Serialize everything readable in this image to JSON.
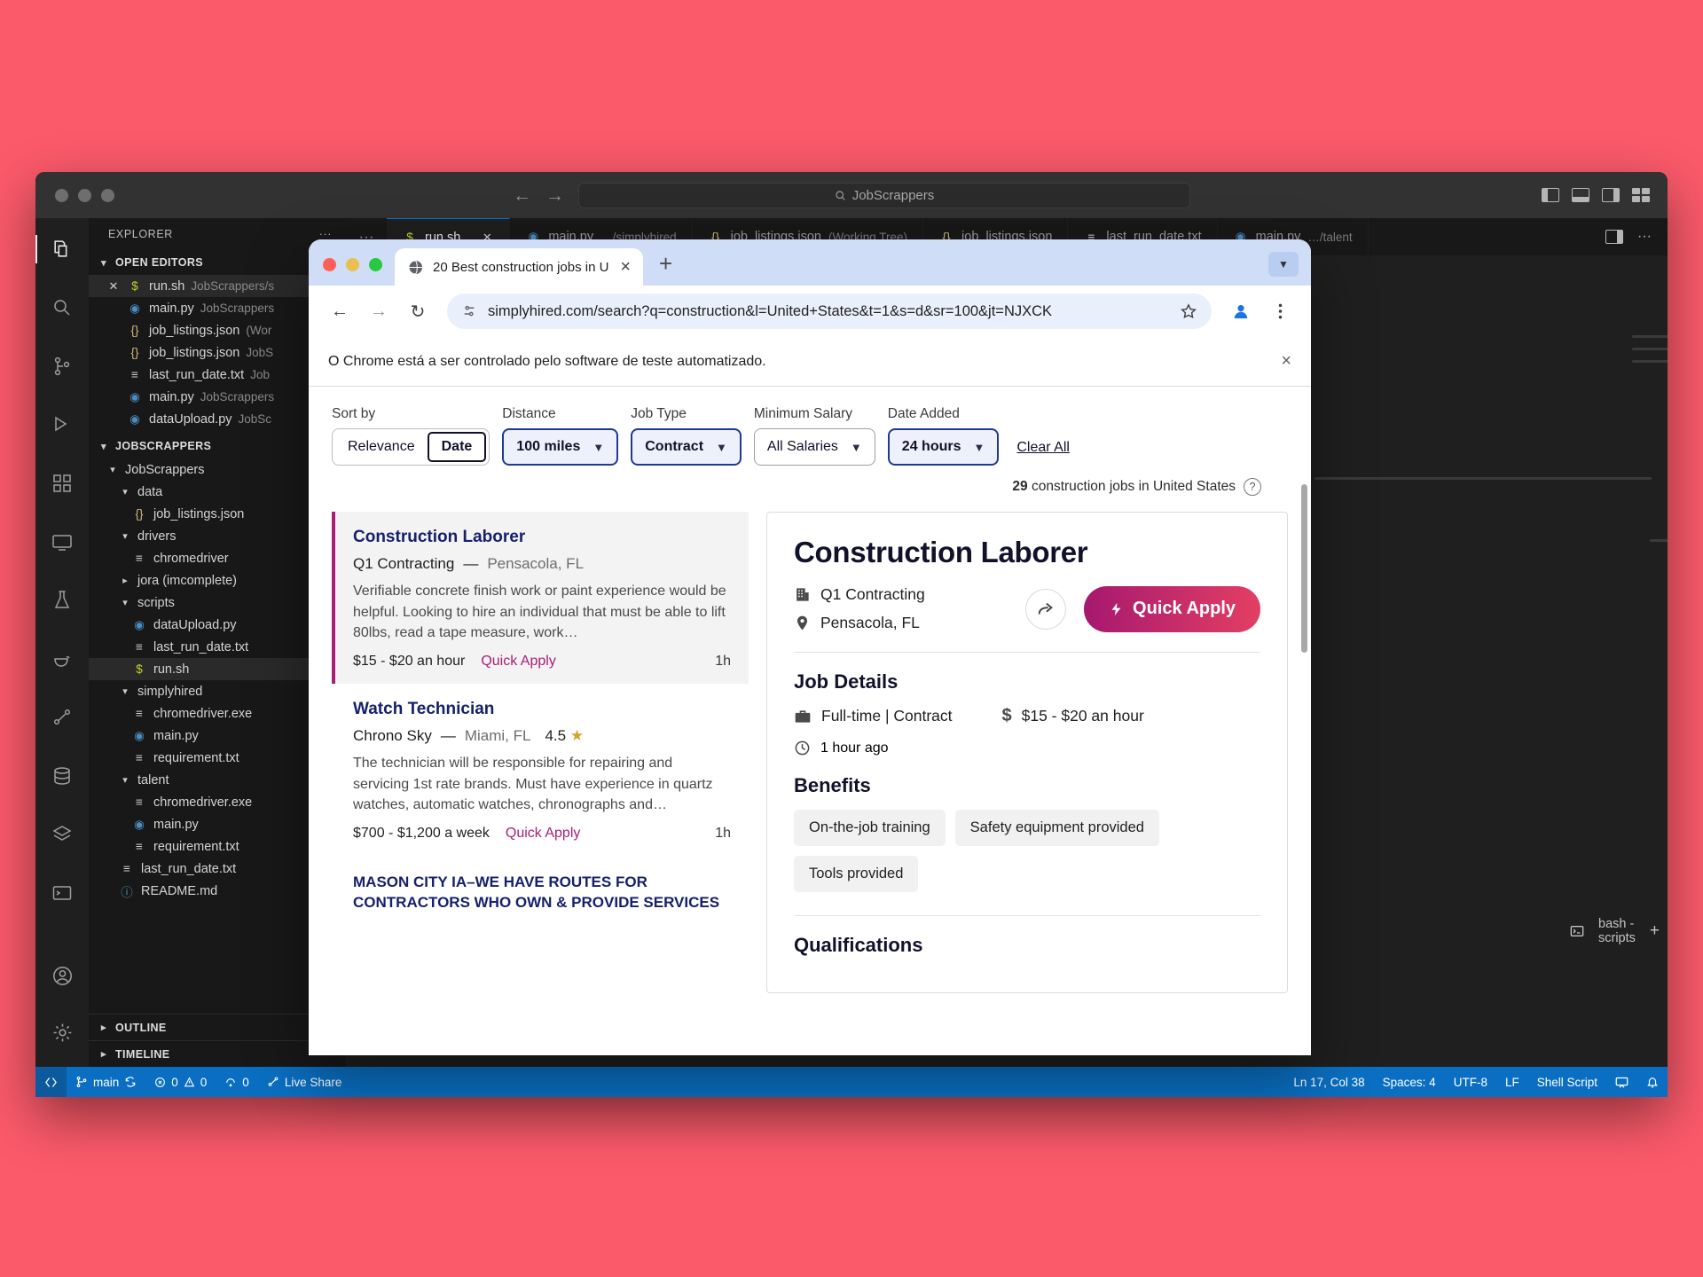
{
  "vscode": {
    "window_controls": [
      "close",
      "minimize",
      "maximize"
    ],
    "command_center": {
      "icon": "search-icon",
      "text": "JobScrappers"
    },
    "nav": {
      "back": "←",
      "forward": "→"
    },
    "sidebar": {
      "header": "EXPLORER",
      "more_actions": "···",
      "open_editors": {
        "label": "OPEN EDITORS",
        "items": [
          {
            "icon": "sh",
            "name": "run.sh",
            "path": "JobScrappers/s",
            "selected": true,
            "closeable": true
          },
          {
            "icon": "py",
            "name": "main.py",
            "path": "JobScrappers",
            "selected": false
          },
          {
            "icon": "json",
            "name": "job_listings.json",
            "path": "(Wor",
            "selected": false
          },
          {
            "icon": "json",
            "name": "job_listings.json",
            "path": "JobS",
            "selected": false
          },
          {
            "icon": "txt",
            "name": "last_run_date.txt",
            "path": "Job",
            "selected": false
          },
          {
            "icon": "py",
            "name": "main.py",
            "path": "JobScrappers",
            "selected": false
          },
          {
            "icon": "py",
            "name": "dataUpload.py",
            "path": "JobSc",
            "selected": false
          }
        ]
      },
      "workspace": {
        "label": "JOBSCRAPPERS",
        "tree": [
          {
            "depth": 1,
            "type": "folder",
            "open": true,
            "name": "JobScrappers"
          },
          {
            "depth": 2,
            "type": "folder",
            "open": true,
            "name": "data"
          },
          {
            "depth": 3,
            "type": "file",
            "icon": "json",
            "name": "job_listings.json"
          },
          {
            "depth": 2,
            "type": "folder",
            "open": true,
            "name": "drivers"
          },
          {
            "depth": 3,
            "type": "file",
            "icon": "txt",
            "name": "chromedriver"
          },
          {
            "depth": 2,
            "type": "folder",
            "open": false,
            "name": "jora (imcomplete)"
          },
          {
            "depth": 2,
            "type": "folder",
            "open": true,
            "name": "scripts"
          },
          {
            "depth": 3,
            "type": "file",
            "icon": "py",
            "name": "dataUpload.py"
          },
          {
            "depth": 3,
            "type": "file",
            "icon": "txt",
            "name": "last_run_date.txt"
          },
          {
            "depth": 3,
            "type": "file",
            "icon": "sh",
            "name": "run.sh",
            "selected": true
          },
          {
            "depth": 2,
            "type": "folder",
            "open": true,
            "name": "simplyhired"
          },
          {
            "depth": 3,
            "type": "file",
            "icon": "txt",
            "name": "chromedriver.exe"
          },
          {
            "depth": 3,
            "type": "file",
            "icon": "py",
            "name": "main.py"
          },
          {
            "depth": 3,
            "type": "file",
            "icon": "txt",
            "name": "requirement.txt"
          },
          {
            "depth": 2,
            "type": "folder",
            "open": true,
            "name": "talent"
          },
          {
            "depth": 3,
            "type": "file",
            "icon": "txt",
            "name": "chromedriver.exe"
          },
          {
            "depth": 3,
            "type": "file",
            "icon": "py",
            "name": "main.py"
          },
          {
            "depth": 3,
            "type": "file",
            "icon": "txt",
            "name": "requirement.txt"
          },
          {
            "depth": 2,
            "type": "file",
            "icon": "txt",
            "name": "last_run_date.txt"
          },
          {
            "depth": 2,
            "type": "file",
            "icon": "md",
            "name": "README.md"
          }
        ]
      },
      "outline_label": "OUTLINE",
      "timeline_label": "TIMELINE"
    },
    "tabs": [
      {
        "icon": "sh",
        "name": "run.sh",
        "path": "",
        "active": true,
        "closeable": true
      },
      {
        "icon": "py",
        "name": "main.py",
        "path": "…/simplyhired",
        "active": false
      },
      {
        "icon": "json",
        "name": "job_listings.json",
        "path": "(Working Tree)",
        "active": false
      },
      {
        "icon": "json",
        "name": "job_listings.json",
        "path": "",
        "active": false
      },
      {
        "icon": "txt",
        "name": "last_run_date.txt",
        "path": "",
        "active": false
      },
      {
        "icon": "py",
        "name": "main.py",
        "path": "…/talent",
        "active": false
      }
    ],
    "terminal_toolbar": {
      "shell_label": "bash - scripts",
      "actions": [
        "new-terminal",
        "split-terminal",
        "kill-terminal",
        "more",
        "maximize",
        "close"
      ]
    },
    "statusbar": {
      "remote_icon": "remote-indicator",
      "branch": "main",
      "sync_icon": "sync-icon",
      "errors": "0",
      "warnings": "0",
      "ports": "0",
      "live_share": "Live Share",
      "cursor": "Ln 17, Col 38",
      "spaces": "Spaces: 4",
      "encoding": "UTF-8",
      "eol": "LF",
      "language": "Shell Script",
      "bell_icon": "bell-icon",
      "feedback_icon": "feedback-icon"
    }
  },
  "chrome": {
    "traffic": {
      "close": "#ff5f57",
      "minimize": "#ebbe4e",
      "maximize": "#28c840"
    },
    "tab": {
      "title": "20 Best construction jobs in U",
      "favicon": "globe-icon",
      "close_label": "×"
    },
    "new_tab_label": "+",
    "tab_search_icon": "chevron-down-icon",
    "toolbar": {
      "back": "←",
      "forward": "→",
      "reload": "↻",
      "site_info_icon": "tune-icon",
      "url": "simplyhired.com/search?q=construction&l=United+States&t=1&s=d&sr=100&jt=NJXCK",
      "bookmark_icon": "star-icon",
      "profile_icon": "avatar-icon",
      "menu_icon": "kebab-menu-icon"
    },
    "infobar": {
      "message": "O Chrome está a ser controlado pelo software de teste automatizado.",
      "close_label": "×"
    }
  },
  "page": {
    "filters": {
      "sort_by": {
        "label": "Sort by",
        "options": [
          "Relevance",
          "Date"
        ],
        "selected": "Date"
      },
      "distance": {
        "label": "Distance",
        "value": "100 miles",
        "active": true
      },
      "job_type": {
        "label": "Job Type",
        "value": "Contract",
        "active": true
      },
      "minimum_salary": {
        "label": "Minimum Salary",
        "value": "All Salaries",
        "active": false
      },
      "date_added": {
        "label": "Date Added",
        "value": "24 hours",
        "active": true
      },
      "clear_all": "Clear All"
    },
    "result_count": {
      "number": "29",
      "text": "construction jobs in United States",
      "help_icon": "question-mark-icon"
    },
    "jobs": [
      {
        "title": "Construction Laborer",
        "company": "Q1 Contracting",
        "dash": "—",
        "location": "Pensacola, FL",
        "rating": "",
        "description": "Verifiable concrete finish work or paint experience would be helpful. Looking to hire an individual that must be able to lift 80lbs, read a tape measure, work…",
        "salary": "$15 - $20 an hour",
        "quick_apply": "Quick Apply",
        "posted": "1h",
        "selected": true
      },
      {
        "title": "Watch Technician",
        "company": "Chrono Sky",
        "dash": "—",
        "location": "Miami, FL",
        "rating": "4.5",
        "description": "The technician will be responsible for repairing and servicing 1st rate brands. Must have experience in quartz watches, automatic watches, chronographs and…",
        "salary": "$700 - $1,200 a week",
        "quick_apply": "Quick Apply",
        "posted": "1h",
        "selected": false
      },
      {
        "title": "MASON CITY IA–WE HAVE ROUTES FOR CONTRACTORS WHO OWN & PROVIDE SERVICES",
        "company": "",
        "dash": "",
        "location": "",
        "rating": "",
        "description": "",
        "salary": "",
        "quick_apply": "",
        "posted": "",
        "selected": false
      }
    ],
    "detail": {
      "title": "Construction Laborer",
      "company": "Q1 Contracting",
      "company_icon": "building-icon",
      "location": "Pensacola, FL",
      "location_icon": "map-pin-icon",
      "share_icon": "share-icon",
      "quick_apply": {
        "label": "Quick Apply",
        "icon": "lightning-bolt-icon"
      },
      "job_details_heading": "Job Details",
      "employment_type": "Full-time | Contract",
      "employment_icon": "briefcase-icon",
      "salary": "$15 - $20 an hour",
      "salary_icon": "dollar-icon",
      "posted": "1 hour ago",
      "posted_icon": "clock-icon",
      "benefits_heading": "Benefits",
      "benefits": [
        "On-the-job training",
        "Safety equipment provided",
        "Tools provided"
      ],
      "qualifications_heading": "Qualifications"
    }
  },
  "colors": {
    "desktop": "#fb5a6a",
    "accent_pink": "#a81e78",
    "link_navy": "#16216b",
    "status_blue": "#0a6fc2"
  }
}
